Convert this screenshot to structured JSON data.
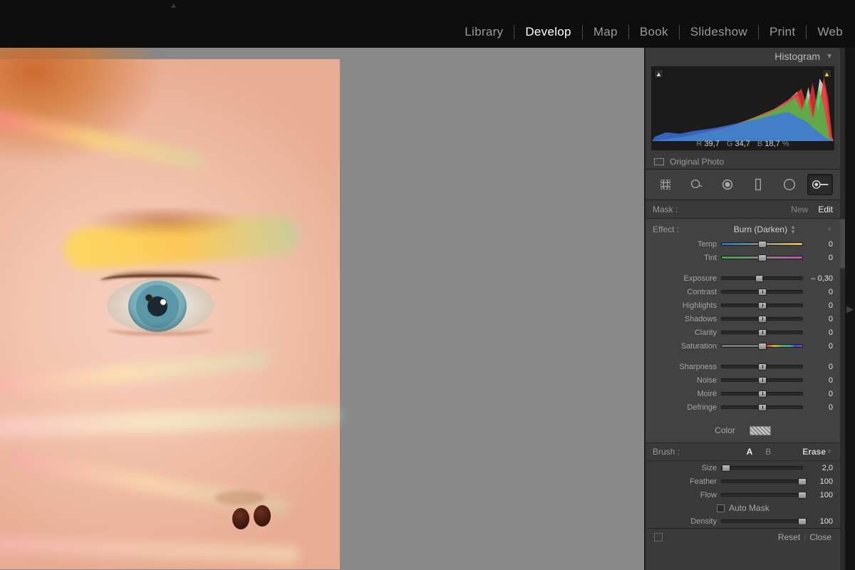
{
  "modules": {
    "items": [
      "Library",
      "Develop",
      "Map",
      "Book",
      "Slideshow",
      "Print",
      "Web"
    ],
    "active": "Develop"
  },
  "histogram": {
    "title": "Histogram",
    "readout": {
      "r_lbl": "R",
      "r": "39,7",
      "g_lbl": "G",
      "g": "34,7",
      "b_lbl": "B",
      "b": "18,7",
      "pct": "%"
    },
    "original_label": "Original Photo"
  },
  "mask": {
    "label": "Mask :",
    "new": "New",
    "edit": "Edit"
  },
  "effect": {
    "label": "Effect :",
    "selected": "Burn (Darken)"
  },
  "sliders1": [
    {
      "label": "Temp",
      "value": "0",
      "pos": 50,
      "track": "g-temp"
    },
    {
      "label": "Tint",
      "value": "0",
      "pos": 50,
      "track": "g-tint"
    }
  ],
  "sliders2": [
    {
      "label": "Exposure",
      "value": "– 0,30",
      "pos": 47,
      "track": "split"
    },
    {
      "label": "Contrast",
      "value": "0",
      "pos": 50,
      "track": "split"
    },
    {
      "label": "Highlights",
      "value": "0",
      "pos": 50,
      "track": "split"
    },
    {
      "label": "Shadows",
      "value": "0",
      "pos": 50,
      "track": "split"
    },
    {
      "label": "Clarity",
      "value": "0",
      "pos": 50,
      "track": "split"
    },
    {
      "label": "Saturation",
      "value": "0",
      "pos": 50,
      "track": "g-sat"
    }
  ],
  "sliders3": [
    {
      "label": "Sharpness",
      "value": "0",
      "pos": 50,
      "track": "split"
    },
    {
      "label": "Noise",
      "value": "0",
      "pos": 50,
      "track": "split"
    },
    {
      "label": "Moiré",
      "value": "0",
      "pos": 50,
      "track": "split"
    },
    {
      "label": "Defringe",
      "value": "0",
      "pos": 50,
      "track": "split"
    }
  ],
  "color_label": "Color",
  "brush": {
    "label": "Brush :",
    "tabs": {
      "a": "A",
      "b": "B",
      "erase": "Erase",
      "active": "A"
    },
    "size": {
      "label": "Size",
      "value": "2,0",
      "pos": 5
    },
    "feather": {
      "label": "Feather",
      "value": "100",
      "pos": 100
    },
    "flow": {
      "label": "Flow",
      "value": "100",
      "pos": 100
    },
    "automask": "Auto Mask",
    "density": {
      "label": "Density",
      "value": "100",
      "pos": 100
    }
  },
  "footer": {
    "reset": "Reset",
    "close": "Close"
  }
}
